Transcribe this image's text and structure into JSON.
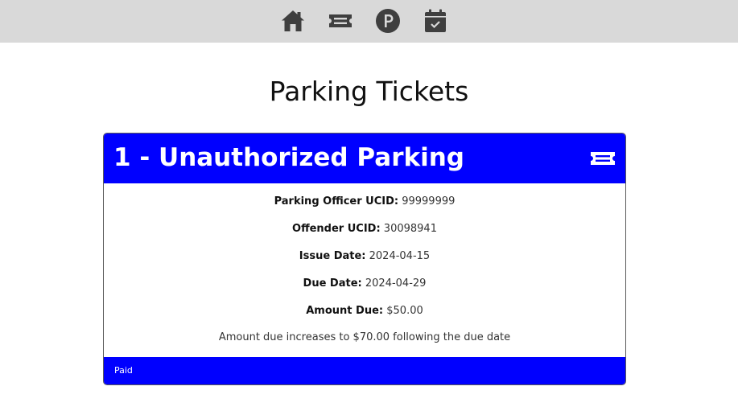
{
  "nav": {
    "items": [
      {
        "icon": "home-icon"
      },
      {
        "icon": "ticket-icon"
      },
      {
        "icon": "parking-icon"
      },
      {
        "icon": "calendar-check-icon"
      }
    ],
    "icon_color": "#3f3f3f",
    "background": "#d9d9d9"
  },
  "page": {
    "title": "Parking Tickets"
  },
  "ticket": {
    "title": "1 - Unauthorized Parking",
    "header_icon": "ticket-icon",
    "accent_color": "#0000ff",
    "fields": [
      {
        "label": "Parking Officer UCID:",
        "value": "99999999"
      },
      {
        "label": "Offender UCID:",
        "value": "30098941"
      },
      {
        "label": "Issue Date:",
        "value": "2024-04-15"
      },
      {
        "label": "Due Date:",
        "value": "2024-04-29"
      },
      {
        "label": "Amount Due:",
        "value": "$50.00"
      }
    ],
    "note": "Amount due increases to $70.00 following the due date",
    "status": "Paid"
  }
}
